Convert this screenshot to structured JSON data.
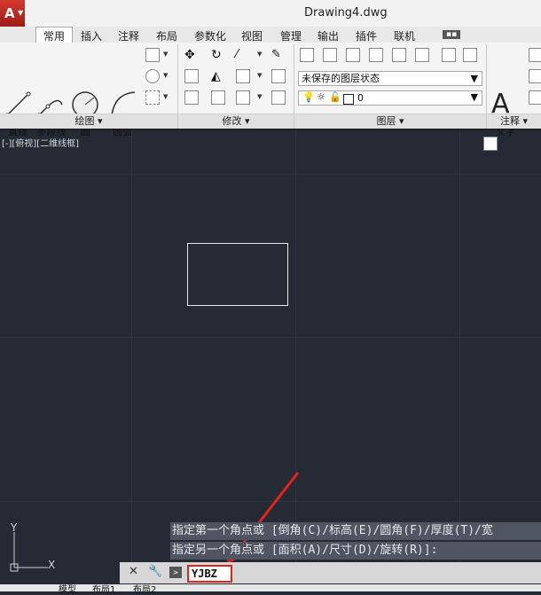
{
  "app": {
    "logo_letter": "A",
    "title": "Drawing4.dwg"
  },
  "tabs": [
    "常用",
    "插入",
    "注释",
    "布局",
    "参数化",
    "视图",
    "管理",
    "输出",
    "插件",
    "联机",
    "▪▪"
  ],
  "panels": {
    "draw": {
      "title": "绘图 ▾",
      "tools": [
        "直线",
        "多段线",
        "圆",
        "圆弧"
      ]
    },
    "modify": {
      "title": "修改 ▾"
    },
    "layers": {
      "title": "图层 ▾",
      "state": "未保存的图层状态",
      "current_layer": "0"
    },
    "annotate": {
      "title": "注释 ▾",
      "text_tool": "文字",
      "big_letter": "A"
    }
  },
  "viewport": {
    "label": "[-][俯视][二维线框]"
  },
  "ucs": {
    "x": "X",
    "y": "Y"
  },
  "command": {
    "history": [
      "指定第一个角点或 [倒角(C)/标高(E)/圆角(F)/厚度(T)/宽",
      "指定另一个角点或 [面积(A)/尺寸(D)/旋转(R)]:"
    ],
    "input": "YJBZ"
  },
  "layout_tabs": [
    "模型",
    "布局1",
    "布局2"
  ],
  "colors": {
    "canvas": "#252a35",
    "highlight": "#e3231c",
    "accent": "#c0231b"
  }
}
